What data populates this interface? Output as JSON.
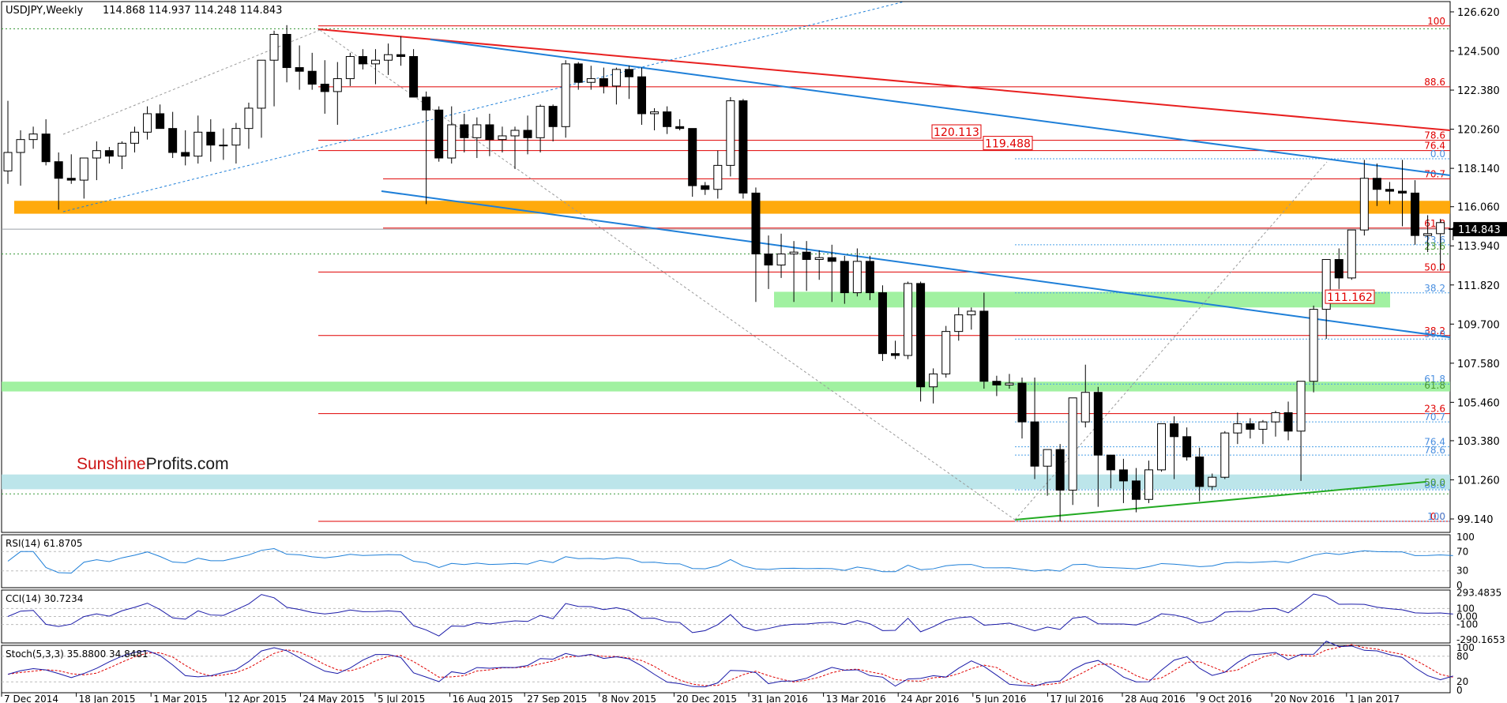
{
  "header": {
    "symbol": "USDJPY,Weekly",
    "ohlc": "114.868 114.937 114.248 114.843"
  },
  "watermark": {
    "part1": "Sunshine",
    "part2": "Profits.com"
  },
  "colors": {
    "bg": "#ffffff",
    "bull_body": "#ffffff",
    "bear_body": "#000000",
    "orange_zone": "#ffa500",
    "green_zone": "#90ee90",
    "blue_zone": "#b0e0e6",
    "red_line": "#e82020",
    "fib_red": "#e00000",
    "blue_line": "#1e7fd8",
    "green_line": "#22aa22",
    "indicator": "#1e7fd8",
    "stoch_main": "#1a1aa8",
    "stoch_signal": "#e00000",
    "cci_line": "#1a1aa8"
  },
  "chart_data": {
    "type": "candlestick",
    "timeframe": "Weekly",
    "price_axis": {
      "ticks": [
        "126.620",
        "124.500",
        "122.380",
        "120.260",
        "118.140",
        "116.060",
        "113.940",
        "111.820",
        "109.700",
        "107.580",
        "105.460",
        "103.380",
        "101.260",
        "99.140"
      ],
      "range": [
        98.4,
        127.2
      ],
      "current_price": "114.843"
    },
    "x_axis_labels": [
      "7 Dec 2014",
      "18 Jan 2015",
      "1 Mar 2015",
      "12 Apr 2015",
      "24 May 2015",
      "5 Jul 2015",
      "16 Aug 2015",
      "27 Sep 2015",
      "8 Nov 2015",
      "20 Dec 2015",
      "31 Jan 2016",
      "13 Mar 2016",
      "24 Apr 2016",
      "5 Jun 2016",
      "17 Jul 2016",
      "28 Aug 2016",
      "9 Oct 2016",
      "20 Nov 2016",
      "1 Jan 2017"
    ],
    "candles": [
      [
        118.0,
        121.8,
        117.3,
        119.0
      ],
      [
        119.0,
        120.2,
        117.2,
        119.7
      ],
      [
        119.7,
        120.4,
        119.2,
        120.0
      ],
      [
        120.0,
        120.8,
        118.3,
        118.5
      ],
      [
        118.5,
        119.0,
        115.9,
        117.6
      ],
      [
        117.6,
        118.9,
        117.3,
        117.5
      ],
      [
        117.5,
        118.6,
        116.5,
        118.7
      ],
      [
        118.7,
        119.6,
        117.5,
        119.1
      ],
      [
        119.1,
        119.3,
        118.4,
        118.8
      ],
      [
        118.8,
        119.6,
        118.1,
        119.5
      ],
      [
        119.5,
        120.4,
        119.0,
        120.1
      ],
      [
        120.1,
        121.5,
        119.7,
        121.1
      ],
      [
        121.1,
        121.6,
        120.5,
        120.3
      ],
      [
        120.3,
        121.2,
        118.7,
        119.0
      ],
      [
        119.0,
        120.2,
        118.3,
        118.8
      ],
      [
        118.8,
        121.0,
        118.4,
        120.1
      ],
      [
        120.1,
        120.8,
        118.5,
        119.4
      ],
      [
        119.4,
        120.3,
        118.6,
        119.4
      ],
      [
        119.4,
        120.6,
        118.4,
        120.3
      ],
      [
        120.3,
        121.7,
        119.2,
        121.4
      ],
      [
        121.4,
        123.4,
        119.8,
        124.0
      ],
      [
        124.0,
        125.6,
        121.5,
        125.4
      ],
      [
        125.4,
        125.9,
        122.8,
        123.6
      ],
      [
        123.6,
        124.8,
        122.4,
        123.4
      ],
      [
        123.4,
        124.4,
        122.4,
        122.7
      ],
      [
        122.7,
        124.0,
        121.1,
        122.3
      ],
      [
        122.3,
        123.9,
        120.5,
        123.0
      ],
      [
        123.0,
        124.4,
        122.6,
        124.2
      ],
      [
        124.2,
        124.6,
        123.5,
        123.8
      ],
      [
        123.8,
        124.6,
        122.7,
        124.0
      ],
      [
        124.0,
        124.9,
        123.2,
        124.3
      ],
      [
        124.3,
        125.3,
        123.7,
        124.2
      ],
      [
        124.2,
        124.6,
        122.6,
        122.0
      ],
      [
        122.0,
        122.3,
        116.2,
        121.3
      ],
      [
        121.3,
        121.5,
        118.5,
        118.7
      ],
      [
        118.7,
        121.5,
        118.4,
        120.5
      ],
      [
        120.5,
        121.1,
        119.0,
        119.8
      ],
      [
        119.8,
        120.9,
        118.7,
        120.5
      ],
      [
        120.5,
        121.1,
        118.8,
        119.7
      ],
      [
        119.7,
        120.4,
        119.0,
        119.9
      ],
      [
        119.9,
        120.4,
        118.1,
        120.2
      ],
      [
        120.2,
        121.0,
        118.9,
        119.8
      ],
      [
        119.8,
        121.6,
        119.0,
        121.5
      ],
      [
        121.5,
        121.6,
        119.6,
        120.4
      ],
      [
        120.4,
        124.0,
        119.8,
        123.8
      ],
      [
        123.8,
        123.9,
        122.4,
        122.8
      ],
      [
        122.8,
        123.7,
        122.4,
        123.0
      ],
      [
        123.0,
        123.6,
        122.2,
        122.6
      ],
      [
        122.6,
        123.6,
        121.6,
        123.5
      ],
      [
        123.5,
        123.7,
        121.9,
        123.1
      ],
      [
        123.1,
        123.6,
        120.5,
        121.1
      ],
      [
        121.1,
        121.4,
        120.2,
        121.2
      ],
      [
        121.2,
        121.5,
        120.0,
        120.4
      ],
      [
        120.4,
        120.8,
        120.2,
        120.3
      ],
      [
        120.3,
        120.3,
        116.6,
        117.2
      ],
      [
        117.2,
        117.4,
        116.7,
        117.0
      ],
      [
        117.0,
        119.1,
        116.5,
        118.3
      ],
      [
        118.3,
        122.0,
        117.7,
        121.8
      ],
      [
        121.8,
        121.9,
        116.5,
        116.8
      ],
      [
        116.8,
        117.1,
        110.9,
        113.5
      ],
      [
        113.5,
        114.5,
        111.6,
        112.9
      ],
      [
        112.9,
        114.6,
        112.2,
        113.5
      ],
      [
        113.5,
        114.2,
        110.9,
        113.6
      ],
      [
        113.6,
        114.2,
        111.5,
        113.2
      ],
      [
        113.2,
        113.7,
        112.1,
        113.3
      ],
      [
        113.3,
        114.0,
        110.9,
        113.1
      ],
      [
        113.1,
        113.4,
        110.8,
        111.4
      ],
      [
        111.4,
        113.8,
        111.2,
        113.1
      ],
      [
        113.1,
        113.4,
        111.0,
        111.4
      ],
      [
        111.4,
        111.8,
        107.7,
        108.1
      ],
      [
        108.1,
        108.8,
        107.8,
        108.0
      ],
      [
        108.0,
        112.0,
        107.8,
        111.9
      ],
      [
        111.9,
        112.0,
        105.5,
        106.3
      ],
      [
        106.3,
        107.3,
        105.4,
        107.0
      ],
      [
        107.0,
        109.6,
        106.8,
        109.3
      ],
      [
        109.3,
        110.6,
        108.8,
        110.2
      ],
      [
        110.2,
        110.6,
        109.4,
        110.4
      ],
      [
        110.4,
        111.4,
        106.2,
        106.6
      ],
      [
        106.6,
        106.9,
        105.8,
        106.4
      ],
      [
        106.4,
        107.0,
        106.2,
        106.5
      ],
      [
        106.5,
        106.8,
        103.5,
        104.4
      ],
      [
        104.4,
        106.8,
        101.3,
        102.0
      ],
      [
        102.0,
        102.9,
        100.4,
        102.9
      ],
      [
        102.9,
        103.2,
        99.0,
        100.7
      ],
      [
        100.7,
        104.6,
        99.9,
        105.7
      ],
      [
        104.4,
        107.5,
        104.1,
        106.0
      ],
      [
        106.0,
        106.3,
        99.8,
        102.6
      ],
      [
        102.6,
        102.6,
        100.8,
        101.8
      ],
      [
        101.8,
        102.4,
        100.0,
        101.2
      ],
      [
        101.2,
        101.9,
        99.5,
        100.2
      ],
      [
        100.2,
        102.3,
        100.0,
        101.8
      ],
      [
        101.8,
        104.3,
        101.7,
        104.3
      ],
      [
        104.3,
        104.7,
        101.3,
        103.6
      ],
      [
        103.6,
        104.1,
        102.3,
        102.5
      ],
      [
        102.5,
        103.0,
        100.1,
        100.9
      ],
      [
        100.9,
        101.6,
        100.7,
        101.4
      ],
      [
        101.4,
        103.9,
        101.3,
        103.8
      ],
      [
        103.8,
        104.9,
        103.2,
        104.3
      ],
      [
        104.3,
        104.6,
        103.5,
        104.0
      ],
      [
        104.0,
        104.5,
        103.2,
        104.4
      ],
      [
        104.4,
        105.0,
        103.6,
        104.9
      ],
      [
        104.9,
        105.5,
        103.4,
        103.9
      ],
      [
        103.9,
        105.4,
        101.2,
        106.6
      ],
      [
        106.6,
        110.7,
        106.0,
        110.5
      ],
      [
        110.5,
        111.0,
        108.9,
        113.2
      ],
      [
        113.2,
        113.8,
        111.6,
        112.2
      ],
      [
        112.2,
        114.5,
        112.1,
        114.8
      ],
      [
        114.8,
        118.6,
        114.5,
        117.6
      ],
      [
        117.6,
        118.4,
        116.1,
        117.0
      ],
      [
        117.0,
        117.4,
        116.2,
        116.9
      ],
      [
        116.9,
        118.6,
        115.0,
        116.8
      ],
      [
        116.8,
        117.5,
        114.0,
        114.5
      ],
      [
        114.5,
        115.6,
        113.6,
        114.6
      ],
      [
        114.6,
        115.4,
        112.6,
        115.2
      ],
      [
        114.868,
        114.937,
        114.248,
        114.843
      ]
    ],
    "zones": [
      {
        "name": "orange-zone",
        "color": "orange",
        "from": 115.68,
        "to": 116.38
      },
      {
        "name": "green-zone-upper",
        "color": "light-green",
        "from": 110.6,
        "to": 111.45
      },
      {
        "name": "green-zone-lower",
        "color": "light-green",
        "from": 106.05,
        "to": 106.58
      },
      {
        "name": "blue-zone",
        "color": "light-blue",
        "from": 100.75,
        "to": 101.55
      }
    ],
    "red_fib_levels": [
      {
        "label": "100",
        "value": 125.86
      },
      {
        "label": "88.6",
        "value": 122.56
      },
      {
        "label": "78.6",
        "value": 119.66
      },
      {
        "label": "76.4",
        "value": 119.1
      },
      {
        "label": "70.7",
        "value": 117.57
      },
      {
        "label": "61.8",
        "value": 114.9
      },
      {
        "label": "50.0",
        "value": 112.52
      },
      {
        "label": "38.2",
        "value": 109.08
      },
      {
        "label": "23.6",
        "value": 104.85
      },
      {
        "label": "0.0",
        "value": 99.01
      }
    ],
    "blue_fib_levels": [
      {
        "label": "0.0",
        "value": 118.66
      },
      {
        "label": "23.6",
        "value": 114.0
      },
      {
        "label": "38.2",
        "value": 111.39
      },
      {
        "label": "50.0",
        "value": 108.89
      },
      {
        "label": "61.8",
        "value": 106.45
      },
      {
        "label": "70.7",
        "value": 104.4
      },
      {
        "label": "76.4",
        "value": 103.05
      },
      {
        "label": "78.6",
        "value": 102.6
      },
      {
        "label": "88.6",
        "value": 100.72
      },
      {
        "label": "100",
        "value": 99.01
      }
    ],
    "green_fib_labels": [
      {
        "label": "23.6",
        "value": 113.64
      },
      {
        "label": "61.8",
        "value": 106.11
      },
      {
        "label": "50.0",
        "value": 100.85
      }
    ],
    "callouts": [
      {
        "text": "120.113",
        "value": 120.113
      },
      {
        "text": "119.488",
        "value": 119.488
      },
      {
        "text": "111.162",
        "value": 111.162
      }
    ],
    "indicators": {
      "rsi": {
        "label": "RSI(14) 61.8705",
        "levels": [
          "100",
          "70",
          "30",
          "0"
        ]
      },
      "cci": {
        "label": "CCI(14) 30.7234",
        "levels": [
          "293.4835",
          "100",
          "0.00",
          "-100",
          "-290.1653"
        ]
      },
      "stoch": {
        "label": "Stoch(5,3,3) 35.8800 34.8481",
        "levels": [
          "100",
          "80",
          "20",
          "0"
        ]
      }
    }
  }
}
